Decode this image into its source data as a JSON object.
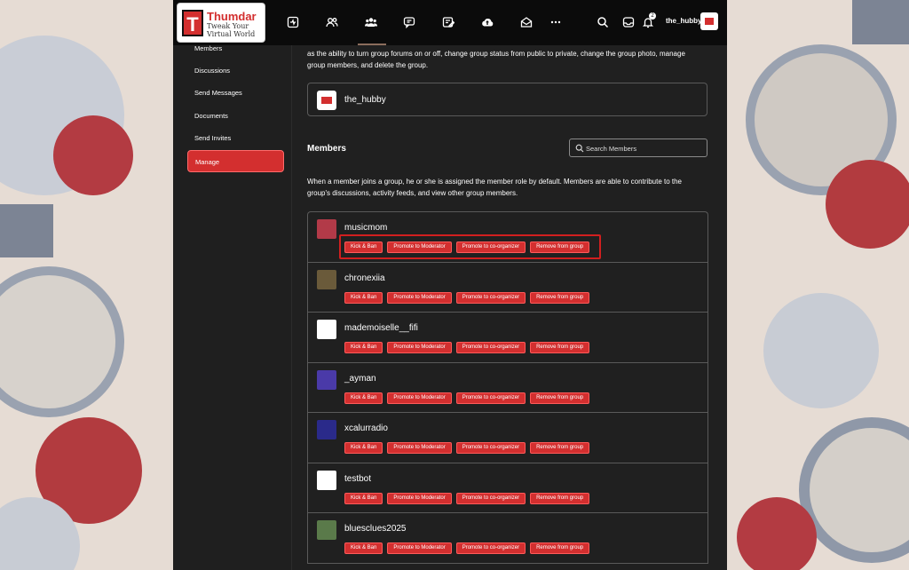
{
  "brand": {
    "name": "Thumdar",
    "tagline": "Tweak Your Virtual World",
    "logo_letter": "T",
    "accent": "#d32f2f"
  },
  "topbar": {
    "icons": [
      "activity-icon",
      "friends-icon",
      "groups-icon",
      "messages-icon",
      "blog-icon",
      "upload-icon",
      "mail-icon",
      "more-icon"
    ],
    "notification_count": "2",
    "username": "the_hubby"
  },
  "sidebar": {
    "items": [
      {
        "label": "Members"
      },
      {
        "label": "Discussions"
      },
      {
        "label": "Send Messages"
      },
      {
        "label": "Documents"
      },
      {
        "label": "Send Invites"
      },
      {
        "label": "Manage",
        "active": true
      }
    ]
  },
  "main": {
    "intro": "as the ability to turn group forums on or off, change group status from public to private, change the group photo, manage group members, and delete the group.",
    "owner": "the_hubby",
    "members_title": "Members",
    "search_placeholder": "Search Members",
    "members_description": "When a member joins a group, he or she is assigned the member role by default. Members are able to contribute to the group's discussions, activity feeds, and view other group members.",
    "actions": [
      "Kick & Ban",
      "Promote to Moderator",
      "Promote to co-organizer",
      "Remove from group"
    ],
    "members": [
      {
        "name": "musicmom",
        "avatar_color": "#b23a48"
      },
      {
        "name": "chronexiia",
        "avatar_color": "#6a5a3a"
      },
      {
        "name": "mademoiselle__fifi",
        "avatar_color": "#ffffff"
      },
      {
        "name": "_ayman",
        "avatar_color": "#4a3aa8"
      },
      {
        "name": "xcalurradio",
        "avatar_color": "#2a2a8a"
      },
      {
        "name": "testbot",
        "avatar_color": "#ffffff"
      },
      {
        "name": "bluesclues2025",
        "avatar_color": "#5a7a4a"
      }
    ]
  }
}
